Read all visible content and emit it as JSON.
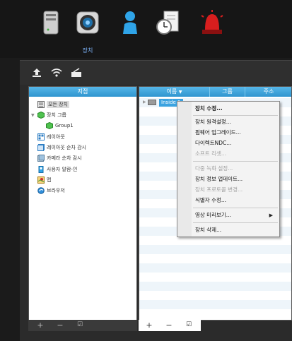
{
  "toolbar": {
    "items": [
      {
        "name": "server-icon"
      },
      {
        "name": "device-camera-icon",
        "label": "장치",
        "selected": true
      },
      {
        "name": "user-icon"
      },
      {
        "name": "schedule-icon"
      },
      {
        "name": "alarm-icon"
      }
    ]
  },
  "subtoolbar": {
    "icons": [
      "upload-icon",
      "wifi-icon",
      "device-register-icon"
    ]
  },
  "tree": {
    "header": "지점",
    "items": [
      {
        "label": "모든 장치",
        "icon": "all-devices-icon",
        "selected": true
      },
      {
        "label": "장치 그룹",
        "icon": "group-icon"
      },
      {
        "label": "Group1",
        "icon": "group-icon"
      },
      {
        "label": "레이아웃",
        "icon": "layout-icon"
      },
      {
        "label": "레이아웃 순차 감시",
        "icon": "layout-sequence-icon"
      },
      {
        "label": "카메라 순차 감시",
        "icon": "camera-sequence-icon"
      },
      {
        "label": "사용자 알람-인",
        "icon": "alarm-in-icon"
      },
      {
        "label": "맵",
        "icon": "map-icon"
      },
      {
        "label": "브라우저",
        "icon": "browser-icon"
      }
    ]
  },
  "list": {
    "columns": [
      "이름",
      "그룹",
      "주소"
    ],
    "selected_row": "Inside 1"
  },
  "context_menu": {
    "items": [
      {
        "label": "장치 수정...",
        "disabled": false,
        "bold": true
      },
      {
        "label": "장치 원격설정...",
        "disabled": false
      },
      {
        "label": "펌웨어 업그레이드...",
        "disabled": false
      },
      {
        "label": "다이렉트NDC...",
        "disabled": false
      },
      {
        "label": "소프트 리셋...",
        "disabled": true
      },
      {
        "label": "다중 녹화 설정...",
        "disabled": true
      },
      {
        "label": "장치 정보 업데이트...",
        "disabled": false
      },
      {
        "label": "장치 프로토콜 변경...",
        "disabled": true
      },
      {
        "label": "식별자 수정...",
        "disabled": false
      },
      {
        "label": "영상 미리보기...",
        "disabled": false,
        "submenu": true
      },
      {
        "label": "장치 삭제...",
        "disabled": false
      }
    ]
  },
  "footer": {
    "add": "+",
    "remove": "−"
  },
  "colors": {
    "accent": "#3ba3e0",
    "header": "#2f95cf"
  }
}
